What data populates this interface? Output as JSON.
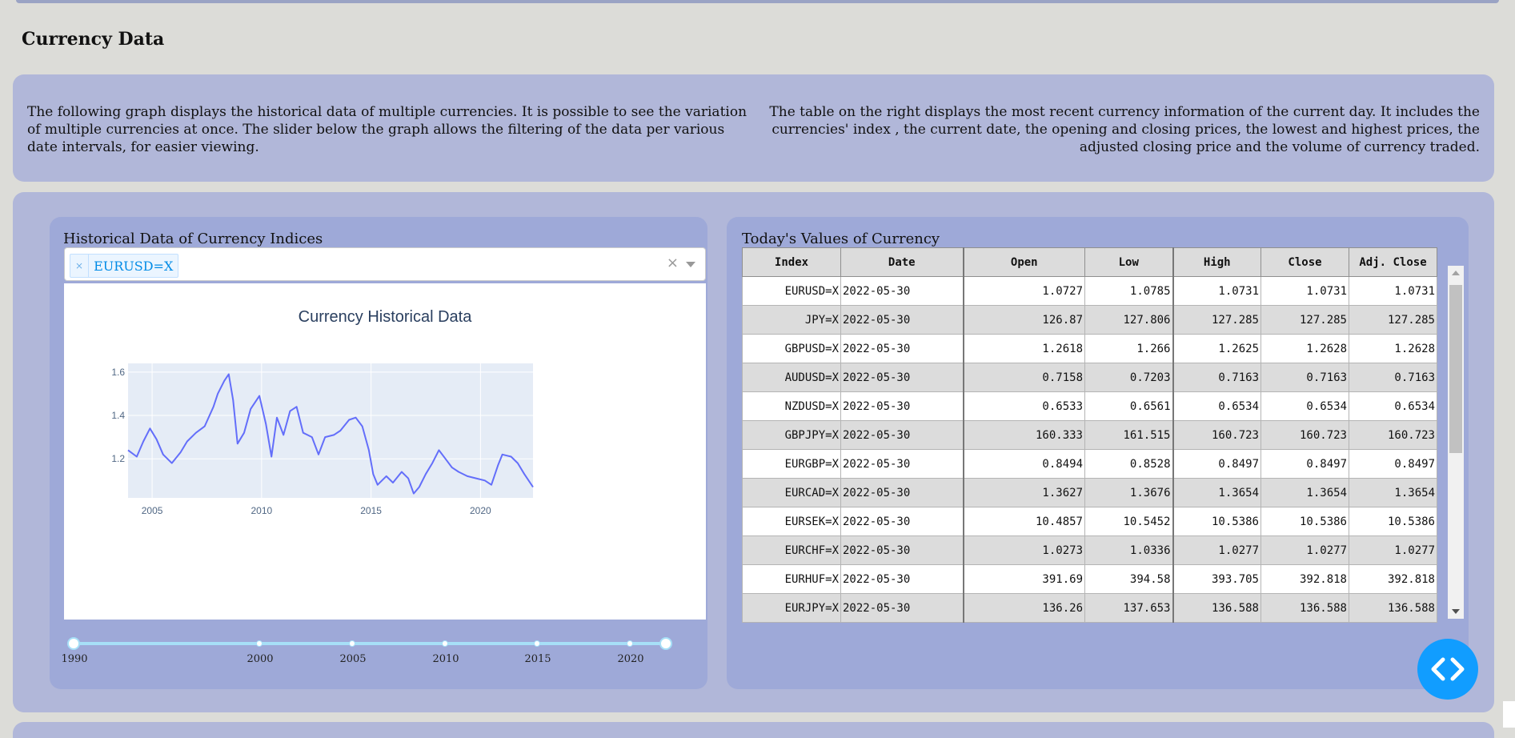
{
  "page": {
    "title": "Currency Data"
  },
  "descriptions": {
    "left": "The following graph displays the historical data of multiple currencies. It is possible to see the variation of multiple currencies at once. The slider below the graph allows the filtering of the data per various date intervals, for easier viewing.",
    "right": "The table on the right displays the most recent currency information of the current day. It includes the currencies' index , the current date, the opening and closing prices, the lowest and highest prices, the adjusted closing price and the volume of currency traded."
  },
  "history_card": {
    "title": "Historical Data of Currency Indices",
    "dropdown": {
      "selected": "EURUSD=X",
      "remove_glyph": "×",
      "clear_glyph": "×"
    },
    "graph": {
      "title": "Currency Historical Data",
      "x_ticks": [
        "2005",
        "2010",
        "2015",
        "2020"
      ],
      "y_ticks": [
        "1.2",
        "1.4",
        "1.6"
      ]
    },
    "slider": {
      "marks": [
        "1990",
        "2000",
        "2005",
        "2010",
        "2015",
        "2020"
      ]
    }
  },
  "chart_data": {
    "type": "line",
    "title": "Currency Historical Data",
    "xlabel": "",
    "ylabel": "",
    "xlim": [
      2003.9,
      2022.4
    ],
    "ylim": [
      1.02,
      1.64
    ],
    "grid": true,
    "series": [
      {
        "name": "EURUSD=X",
        "x": [
          2003.9,
          2004.3,
          2004.6,
          2004.9,
          2005.2,
          2005.5,
          2005.9,
          2006.3,
          2006.6,
          2007.0,
          2007.4,
          2007.8,
          2008.0,
          2008.3,
          2008.5,
          2008.7,
          2008.9,
          2009.2,
          2009.5,
          2009.9,
          2010.2,
          2010.45,
          2010.7,
          2011.0,
          2011.3,
          2011.6,
          2011.9,
          2012.3,
          2012.6,
          2012.9,
          2013.3,
          2013.6,
          2014.0,
          2014.3,
          2014.6,
          2014.9,
          2015.1,
          2015.3,
          2015.7,
          2016.0,
          2016.4,
          2016.7,
          2016.95,
          2017.2,
          2017.5,
          2017.8,
          2018.1,
          2018.4,
          2018.7,
          2019.0,
          2019.4,
          2019.8,
          2020.2,
          2020.5,
          2020.8,
          2021.0,
          2021.4,
          2021.7,
          2022.0,
          2022.4
        ],
        "values": [
          1.24,
          1.21,
          1.28,
          1.34,
          1.29,
          1.22,
          1.18,
          1.23,
          1.28,
          1.32,
          1.35,
          1.44,
          1.5,
          1.56,
          1.59,
          1.47,
          1.27,
          1.32,
          1.43,
          1.49,
          1.36,
          1.21,
          1.39,
          1.31,
          1.42,
          1.44,
          1.32,
          1.3,
          1.22,
          1.3,
          1.31,
          1.33,
          1.38,
          1.39,
          1.35,
          1.24,
          1.13,
          1.08,
          1.12,
          1.09,
          1.14,
          1.11,
          1.04,
          1.07,
          1.13,
          1.18,
          1.24,
          1.2,
          1.16,
          1.14,
          1.12,
          1.11,
          1.1,
          1.08,
          1.17,
          1.22,
          1.21,
          1.18,
          1.13,
          1.07
        ]
      }
    ]
  },
  "today_card": {
    "title": "Today's Values of Currency",
    "columns": [
      "Index",
      "Date",
      "Open",
      "Low",
      "High",
      "Close",
      "Adj. Close"
    ],
    "rows": [
      [
        "EURUSD=X",
        "2022-05-30",
        "1.0727",
        "1.0785",
        "1.0731",
        "1.0731",
        "1.0731"
      ],
      [
        "JPY=X",
        "2022-05-30",
        "126.87",
        "127.806",
        "127.285",
        "127.285",
        "127.285"
      ],
      [
        "GBPUSD=X",
        "2022-05-30",
        "1.2618",
        "1.266",
        "1.2625",
        "1.2628",
        "1.2628"
      ],
      [
        "AUDUSD=X",
        "2022-05-30",
        "0.7158",
        "0.7203",
        "0.7163",
        "0.7163",
        "0.7163"
      ],
      [
        "NZDUSD=X",
        "2022-05-30",
        "0.6533",
        "0.6561",
        "0.6534",
        "0.6534",
        "0.6534"
      ],
      [
        "GBPJPY=X",
        "2022-05-30",
        "160.333",
        "161.515",
        "160.723",
        "160.723",
        "160.723"
      ],
      [
        "EURGBP=X",
        "2022-05-30",
        "0.8494",
        "0.8528",
        "0.8497",
        "0.8497",
        "0.8497"
      ],
      [
        "EURCAD=X",
        "2022-05-30",
        "1.3627",
        "1.3676",
        "1.3654",
        "1.3654",
        "1.3654"
      ],
      [
        "EURSEK=X",
        "2022-05-30",
        "10.4857",
        "10.5452",
        "10.5386",
        "10.5386",
        "10.5386"
      ],
      [
        "EURCHF=X",
        "2022-05-30",
        "1.0273",
        "1.0336",
        "1.0277",
        "1.0277",
        "1.0277"
      ],
      [
        "EURHUF=X",
        "2022-05-30",
        "391.69",
        "394.58",
        "393.705",
        "392.818",
        "392.818"
      ],
      [
        "EURJPY=X",
        "2022-05-30",
        "136.26",
        "137.653",
        "136.588",
        "136.588",
        "136.588"
      ]
    ]
  },
  "icons": {
    "fab": "code-brackets-icon"
  },
  "colors": {
    "line": "#636efa",
    "plot_bg": "#e5ecf6",
    "fab": "#119dff",
    "panel": "#b1b7d9",
    "card": "#9ea9d8"
  }
}
